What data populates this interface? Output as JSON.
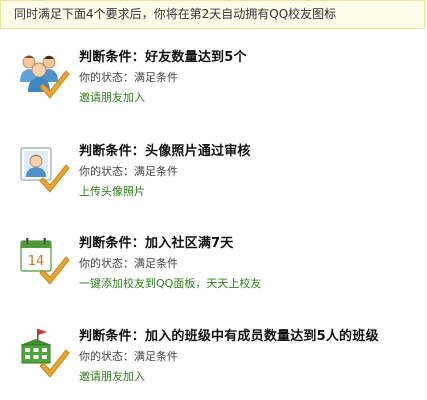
{
  "notice": "同时满足下面4个要求后，你将在第2天自动拥有QQ校友图标",
  "conditions": [
    {
      "icon": "friends-icon",
      "title_prefix": "判断条件：",
      "title": "好友数量达到5个",
      "status_label": "你的状态：",
      "status_value": "满足条件",
      "link": "邀请朋友加入"
    },
    {
      "icon": "avatar-photo-icon",
      "title_prefix": "判断条件：",
      "title": "头像照片通过审核",
      "status_label": "你的状态：",
      "status_value": "满足条件",
      "link": "上传头像照片"
    },
    {
      "icon": "calendar-icon",
      "title_prefix": "判断条件：",
      "title": "加入社区满7天",
      "status_label": "你的状态：",
      "status_value": "满足条件",
      "link": "一键添加校友到QQ面板，天天上校友",
      "calendar_day": "14"
    },
    {
      "icon": "class-building-icon",
      "title_prefix": "判断条件：",
      "title": "加入的班级中有成员数量达到5人的班级",
      "status_label": "你的状态：",
      "status_value": "满足条件",
      "link": "邀请朋友加入"
    }
  ],
  "colors": {
    "notice_bg": "#fefdea",
    "notice_border": "#f2e19a",
    "link": "#2b7f16",
    "check": "#e8a530"
  }
}
